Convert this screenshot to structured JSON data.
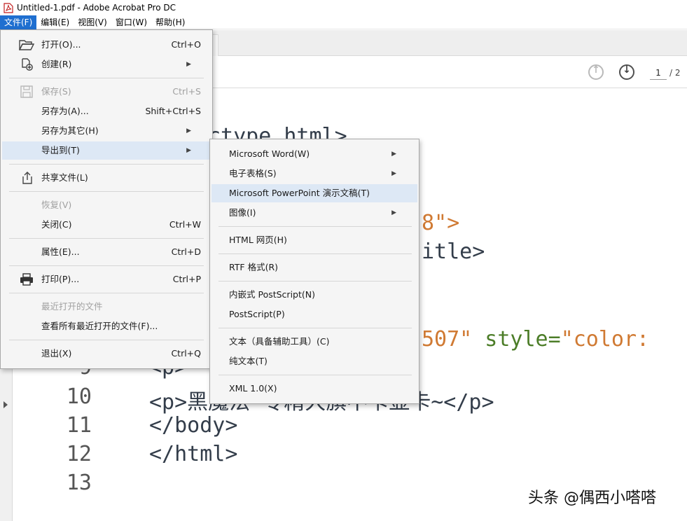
{
  "window": {
    "title": "Untitled-1.pdf - Adobe Acrobat Pro DC"
  },
  "menubar": [
    {
      "label": "文件(F)",
      "active": true
    },
    {
      "label": "编辑(E)"
    },
    {
      "label": "视图(V)"
    },
    {
      "label": "窗口(W)"
    },
    {
      "label": "帮助(H)"
    }
  ],
  "tab": {
    "close": "×"
  },
  "toolbar": {
    "page_current": "1",
    "page_total": "/ 2"
  },
  "file_menu": {
    "open": {
      "label": "打开(O)...",
      "shortcut": "Ctrl+O"
    },
    "create": {
      "label": "创建(R)"
    },
    "save": {
      "label": "保存(S)",
      "shortcut": "Ctrl+S"
    },
    "save_as": {
      "label": "另存为(A)...",
      "shortcut": "Shift+Ctrl+S"
    },
    "save_as_other": {
      "label": "另存为其它(H)"
    },
    "export_to": {
      "label": "导出到(T)"
    },
    "share": {
      "label": "共享文件(L)"
    },
    "revert": {
      "label": "恢复(V)"
    },
    "close": {
      "label": "关闭(C)",
      "shortcut": "Ctrl+W"
    },
    "properties": {
      "label": "属性(E)...",
      "shortcut": "Ctrl+D"
    },
    "print": {
      "label": "打印(P)...",
      "shortcut": "Ctrl+P"
    },
    "recent_header": {
      "label": "最近打开的文件"
    },
    "view_recent": {
      "label": "查看所有最近打开的文件(F)..."
    },
    "exit": {
      "label": "退出(X)",
      "shortcut": "Ctrl+Q"
    }
  },
  "export_menu": {
    "word": "Microsoft Word(W)",
    "spreadsheet": "电子表格(S)",
    "powerpoint": "Microsoft PowerPoint 演示文稿(T)",
    "image": "图像(I)",
    "html": "HTML 网页(H)",
    "rtf": "RTF 格式(R)",
    "embedded_ps": "内嵌式 PostScript(N)",
    "postscript": "PostScript(P)",
    "text_accessible": "文本（具备辅助工具）(C)",
    "plain_text": "纯文本(T)",
    "xml": "XML 1.0(X)"
  },
  "document": {
    "frag_doctype": "ctype html>",
    "frag_meta": "8\">",
    "frag_title": "itle>",
    "frag_p1_a": "507\"",
    "frag_p1_b": " style=",
    "frag_p1_c": "\"color:",
    "line9_num": "9",
    "line9_text": "<p>",
    "line10_num": "10",
    "line10_text": "<p>黑魔法-专精大旗不卡显卡~</p>",
    "line11_num": "11",
    "line11_text": "</body>",
    "line12_num": "12",
    "line12_text": "</html>",
    "line13_num": "13"
  },
  "watermark": "头条 @偶西小嗒嗒"
}
